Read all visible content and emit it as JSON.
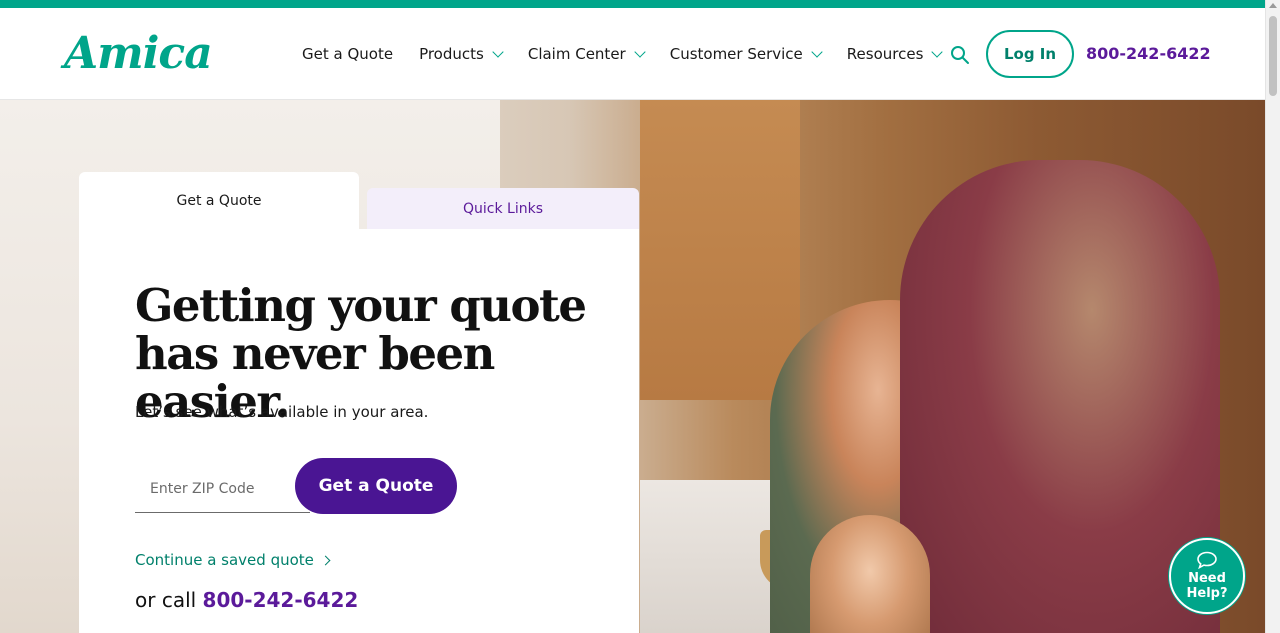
{
  "brand": {
    "logo_text": "Amica",
    "accent": "#00a58a",
    "purple": "#4a1593"
  },
  "nav": {
    "items": [
      {
        "label": "Get a Quote",
        "dropdown": false
      },
      {
        "label": "Products",
        "dropdown": true
      },
      {
        "label": "Claim Center",
        "dropdown": true
      },
      {
        "label": "Customer Service",
        "dropdown": true
      },
      {
        "label": "Resources",
        "dropdown": true
      }
    ],
    "search_icon": "search-icon",
    "login_label": "Log In",
    "phone": "800-242-6422"
  },
  "tabs": {
    "active_label": "Get a Quote",
    "inactive_label": "Quick Links"
  },
  "quote_card": {
    "headline_line1": "Getting your quote",
    "headline_line2": "has never been easier.",
    "subtext": "Let’s see what’s available in your area.",
    "zip_placeholder": "Enter ZIP Code",
    "zip_value": "",
    "button_label": "Get a Quote",
    "saved_link": "Continue a saved quote",
    "call_prefix": "or call",
    "call_phone": "800-242-6422"
  },
  "help": {
    "line1": "Need",
    "line2": "Help?",
    "icon": "chat-bubble-icon"
  }
}
